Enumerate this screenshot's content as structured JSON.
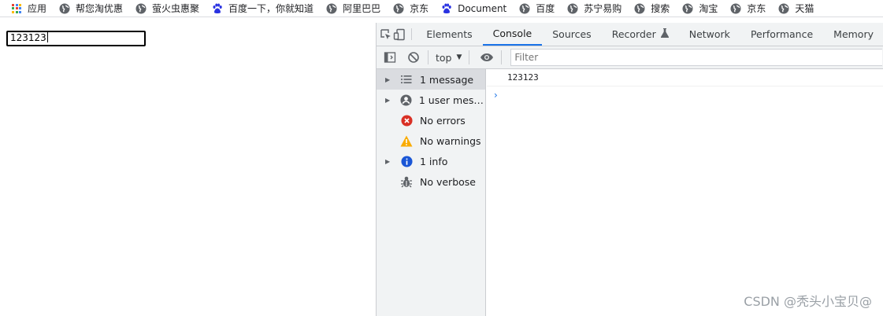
{
  "bookmarks": [
    {
      "label": "应用",
      "icon": "apps-grid-icon"
    },
    {
      "label": "帮您淘优惠",
      "icon": "globe-icon"
    },
    {
      "label": "萤火虫惠聚",
      "icon": "globe-icon"
    },
    {
      "label": "百度一下，你就知道",
      "icon": "baidu-paw-icon"
    },
    {
      "label": "阿里巴巴",
      "icon": "globe-icon"
    },
    {
      "label": "京东",
      "icon": "globe-icon"
    },
    {
      "label": "Document",
      "icon": "baidu-paw-icon"
    },
    {
      "label": "百度",
      "icon": "globe-icon"
    },
    {
      "label": "苏宁易购",
      "icon": "globe-icon"
    },
    {
      "label": "搜索",
      "icon": "globe-icon"
    },
    {
      "label": "淘宝",
      "icon": "globe-icon"
    },
    {
      "label": "京东",
      "icon": "globe-icon"
    },
    {
      "label": "天猫",
      "icon": "globe-icon"
    }
  ],
  "page": {
    "input_value": "123123"
  },
  "devtools": {
    "tabs": [
      {
        "label": "Elements",
        "active": false
      },
      {
        "label": "Console",
        "active": true
      },
      {
        "label": "Sources",
        "active": false
      },
      {
        "label": "Recorder",
        "active": false
      },
      {
        "label": "Network",
        "active": false
      },
      {
        "label": "Performance",
        "active": false
      },
      {
        "label": "Memory",
        "active": false
      }
    ],
    "context": "top",
    "filter_placeholder": "Filter",
    "sidebar": [
      {
        "label": "1 message",
        "icon": "list-icon",
        "expandable": true,
        "selected": true
      },
      {
        "label": "1 user mess...",
        "icon": "user-icon",
        "expandable": true,
        "selected": false
      },
      {
        "label": "No errors",
        "icon": "error-icon",
        "expandable": false,
        "selected": false
      },
      {
        "label": "No warnings",
        "icon": "warning-icon",
        "expandable": false,
        "selected": false
      },
      {
        "label": "1 info",
        "icon": "info-icon",
        "expandable": true,
        "selected": false
      },
      {
        "label": "No verbose",
        "icon": "bug-icon",
        "expandable": false,
        "selected": false
      }
    ],
    "console_log": [
      "123123"
    ],
    "prompt_symbol": "›"
  },
  "watermark": "CSDN @秃头小宝贝@",
  "colors": {
    "accent": "#1a73e8",
    "error": "#d93025",
    "warning": "#f9ab00",
    "info": "#1a56d6"
  }
}
